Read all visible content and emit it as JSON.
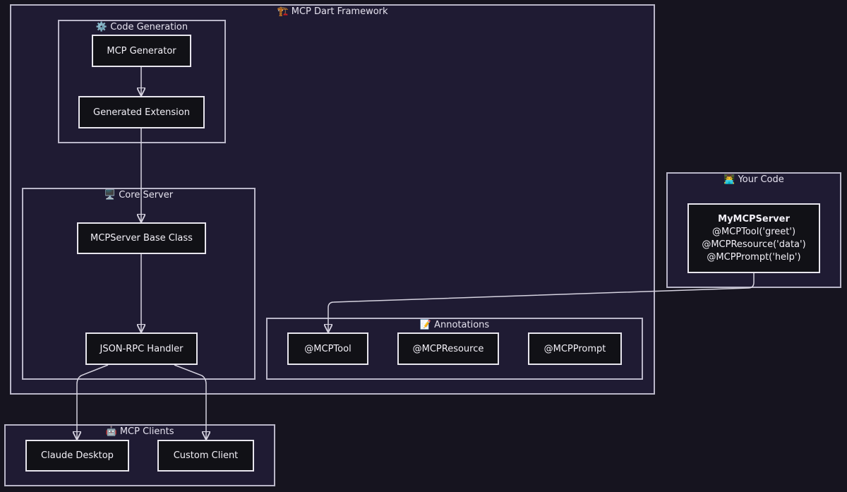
{
  "clusters": {
    "framework": {
      "icon": "🏗️",
      "title": "MCP Dart Framework"
    },
    "codegen": {
      "icon": "⚙️",
      "title": "Code Generation"
    },
    "core": {
      "icon": "🖥️",
      "title": "Core Server"
    },
    "annotations": {
      "icon": "📝",
      "title": "Annotations"
    },
    "yourcode": {
      "icon": "👨‍💻",
      "title": "Your Code"
    },
    "clients": {
      "icon": "🤖",
      "title": "MCP Clients"
    }
  },
  "nodes": {
    "generator": "MCP Generator",
    "extension": "Generated Extension",
    "base_class": "MCPServer Base Class",
    "jsonrpc": "JSON-RPC Handler",
    "mcptool": "@MCPTool",
    "mcpresource": "@MCPResource",
    "mcpprompt": "@MCPPrompt",
    "myserver": {
      "title": "MyMCPServer",
      "lines": [
        "@MCPTool('greet')",
        "@MCPResource('data')",
        "@MCPPrompt('help')"
      ]
    },
    "claude": "Claude Desktop",
    "custom": "Custom Client"
  },
  "colors": {
    "background": "#16141f",
    "cluster_fill": "#1f1b33",
    "cluster_border": "#b9b6c8",
    "node_fill": "#111116",
    "node_border": "#e8e6ee",
    "edge": "#d6d3e0"
  }
}
